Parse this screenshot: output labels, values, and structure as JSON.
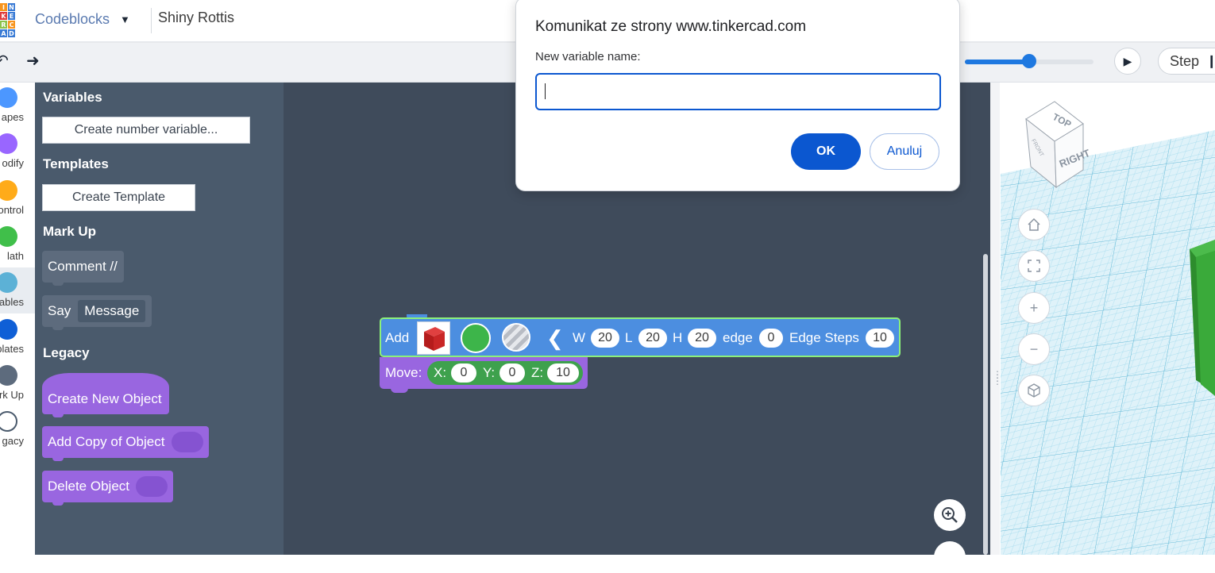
{
  "header": {
    "logo_letters": [
      "I",
      "N",
      "K",
      "E",
      "R",
      "C",
      "A",
      "D"
    ],
    "logo_colors": [
      "#f7941d",
      "#3a7bd5",
      "#e03b3b",
      "#3a7bd5",
      "#8bc34a",
      "#f7941d",
      "#3a7bd5",
      "#3a7bd5"
    ],
    "app_title": "Codeblocks",
    "project_name": "Shiny Rottis"
  },
  "toolbar": {
    "undo_icon": "undo-icon",
    "redo_icon": "redo-icon",
    "speed_fraction": 0.5,
    "step_label": "Step"
  },
  "categories": [
    {
      "label": "Shapes",
      "visible": "apes",
      "color": "#4c97ff"
    },
    {
      "label": "Modify",
      "visible": "odify",
      "color": "#9966ff"
    },
    {
      "label": "Control",
      "visible": "ontrol",
      "color": "#ffab19"
    },
    {
      "label": "Math",
      "visible": "lath",
      "color": "#40bf4a"
    },
    {
      "label": "Variables",
      "visible": "iables",
      "color": "#5cb1d6",
      "active": true
    },
    {
      "label": "Templates",
      "visible": "nplates",
      "color": "#0f5fd6"
    },
    {
      "label": "Mark Up",
      "visible": "rk Up",
      "color": "#5d6b7d"
    },
    {
      "label": "Legacy",
      "visible": "gacy",
      "color": "#ffffff"
    }
  ],
  "flyout": {
    "variables_heading": "Variables",
    "create_number_variable": "Create number variable...",
    "templates_heading": "Templates",
    "create_template": "Create Template",
    "markup_heading": "Mark Up",
    "comment_block": "Comment //",
    "say_label": "Say",
    "say_message": "Message",
    "legacy_heading": "Legacy",
    "create_new_object": "Create New Object",
    "add_copy_of_object": "Add Copy of Object",
    "delete_object": "Delete Object"
  },
  "workspace": {
    "add_block": {
      "add": "Add",
      "w_label": "W",
      "w": "20",
      "l_label": "L",
      "l": "20",
      "h_label": "H",
      "h": "20",
      "edge_label": "edge",
      "edge": "0",
      "edge_steps_label": "Edge Steps",
      "edge_steps": "10",
      "color": "#3db54a"
    },
    "move_block": {
      "move": "Move:",
      "x_label": "X:",
      "x": "0",
      "y_label": "Y:",
      "y": "0",
      "z_label": "Z:",
      "z": "10"
    },
    "zoom_in_icon": "zoom-in-icon"
  },
  "viewport": {
    "view_cube_top": "TOP",
    "view_cube_right": "RIGHT",
    "view_cube_front": "FRONT",
    "nav_icons": [
      "home-icon",
      "fit-icon",
      "zoom-plus-icon",
      "zoom-minus-icon",
      "ortho-icon"
    ]
  },
  "dialog": {
    "title": "Komunikat ze strony www.tinkercad.com",
    "label": "New variable name:",
    "input_value": "",
    "ok": "OK",
    "cancel": "Anuluj"
  }
}
